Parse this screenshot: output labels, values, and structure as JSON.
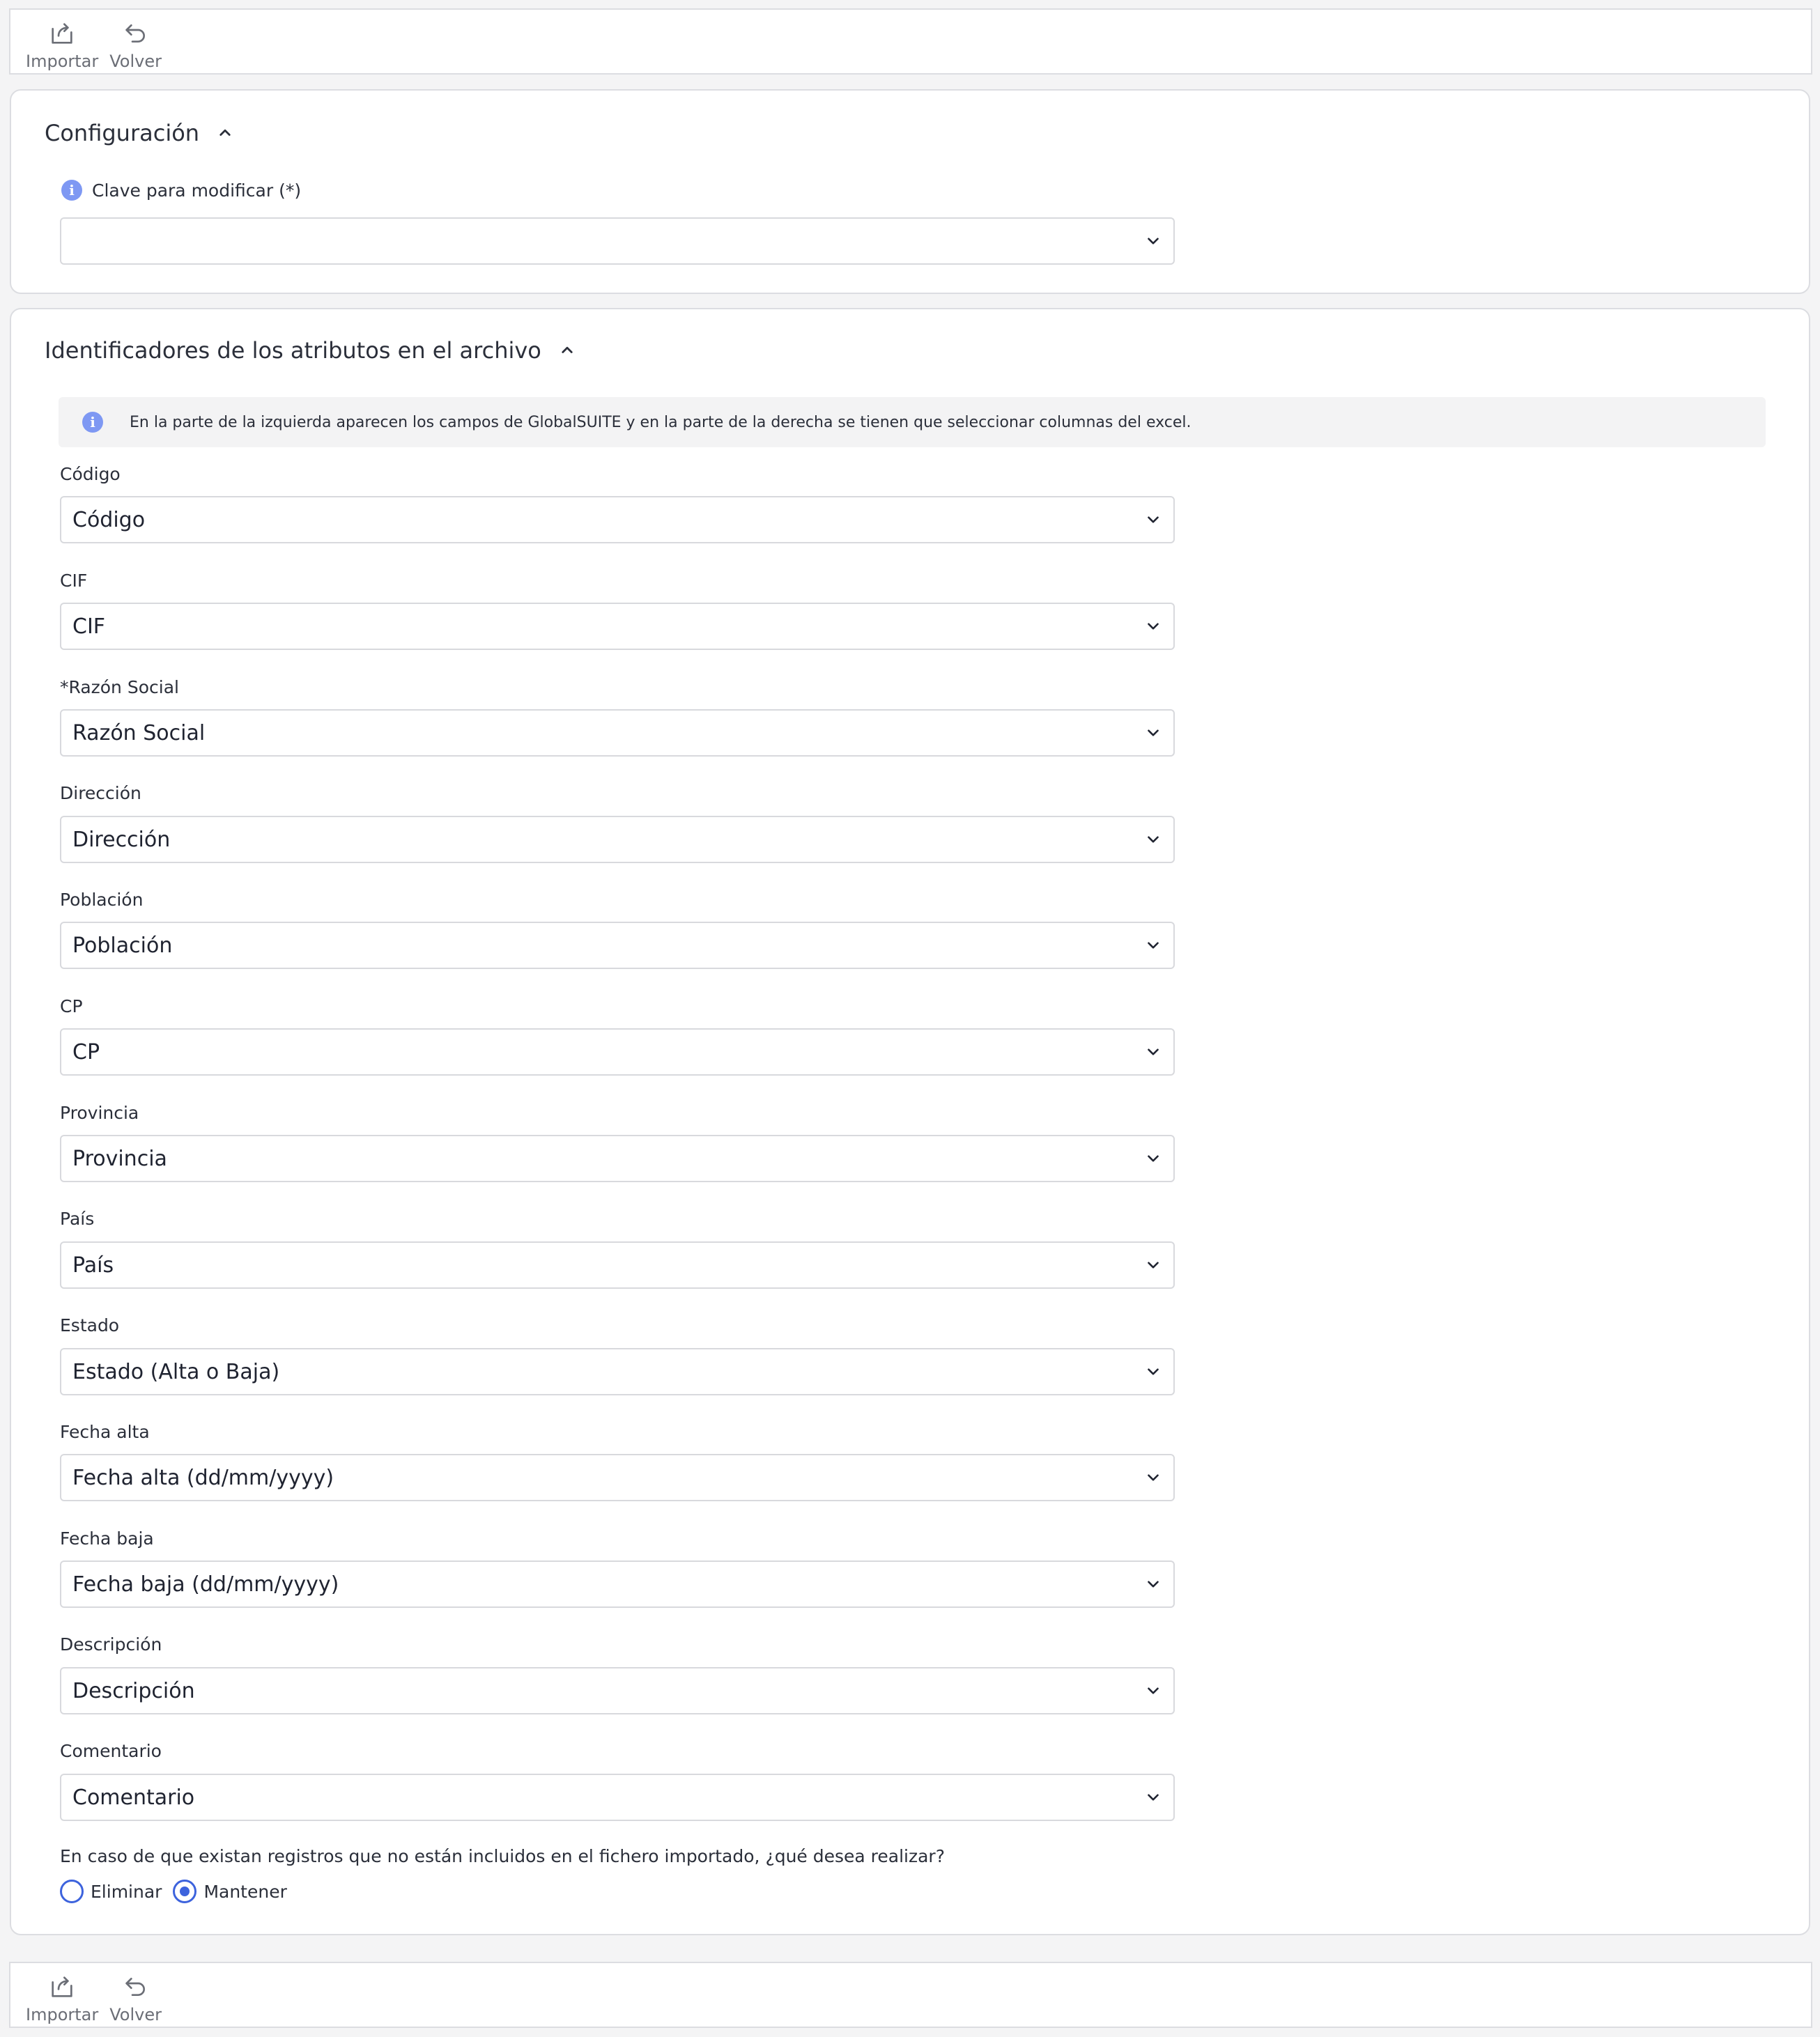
{
  "toolbar": {
    "import_label": "Importar",
    "back_label": "Volver",
    "import_icon": "share-box-icon",
    "back_icon": "undo-icon"
  },
  "config": {
    "title": "Configuración",
    "key_label": "Clave para modificar (*)",
    "key_value": ""
  },
  "identifiers": {
    "title": "Identificadores de los atributos en el archivo",
    "info": "En la parte de la izquierda aparecen los campos de GlobalSUITE y en la parte de la derecha se tienen que seleccionar columnas del excel.",
    "fields": [
      {
        "label": "Código",
        "value": "Código"
      },
      {
        "label": "CIF",
        "value": "CIF"
      },
      {
        "label": "*Razón Social",
        "value": "Razón Social"
      },
      {
        "label": "Dirección",
        "value": "Dirección"
      },
      {
        "label": "Población",
        "value": "Población"
      },
      {
        "label": "CP",
        "value": "CP"
      },
      {
        "label": "Provincia",
        "value": "Provincia"
      },
      {
        "label": "País",
        "value": "País"
      },
      {
        "label": "Estado",
        "value": "Estado (Alta o Baja)"
      },
      {
        "label": "Fecha alta",
        "value": "Fecha alta (dd/mm/yyyy)"
      },
      {
        "label": "Fecha baja",
        "value": "Fecha baja (dd/mm/yyyy)"
      },
      {
        "label": "Descripción",
        "value": "Descripción"
      },
      {
        "label": "Comentario",
        "value": "Comentario"
      }
    ],
    "question": "En caso de que existan registros que no están incluidos en el fichero importado, ¿qué desea realizar?",
    "options": [
      {
        "label": "Eliminar",
        "checked": false
      },
      {
        "label": "Mantener",
        "checked": true
      }
    ]
  },
  "colors": {
    "accent": "#3d63dd",
    "info": "#7e98f3",
    "border": "#d8d9dd"
  }
}
